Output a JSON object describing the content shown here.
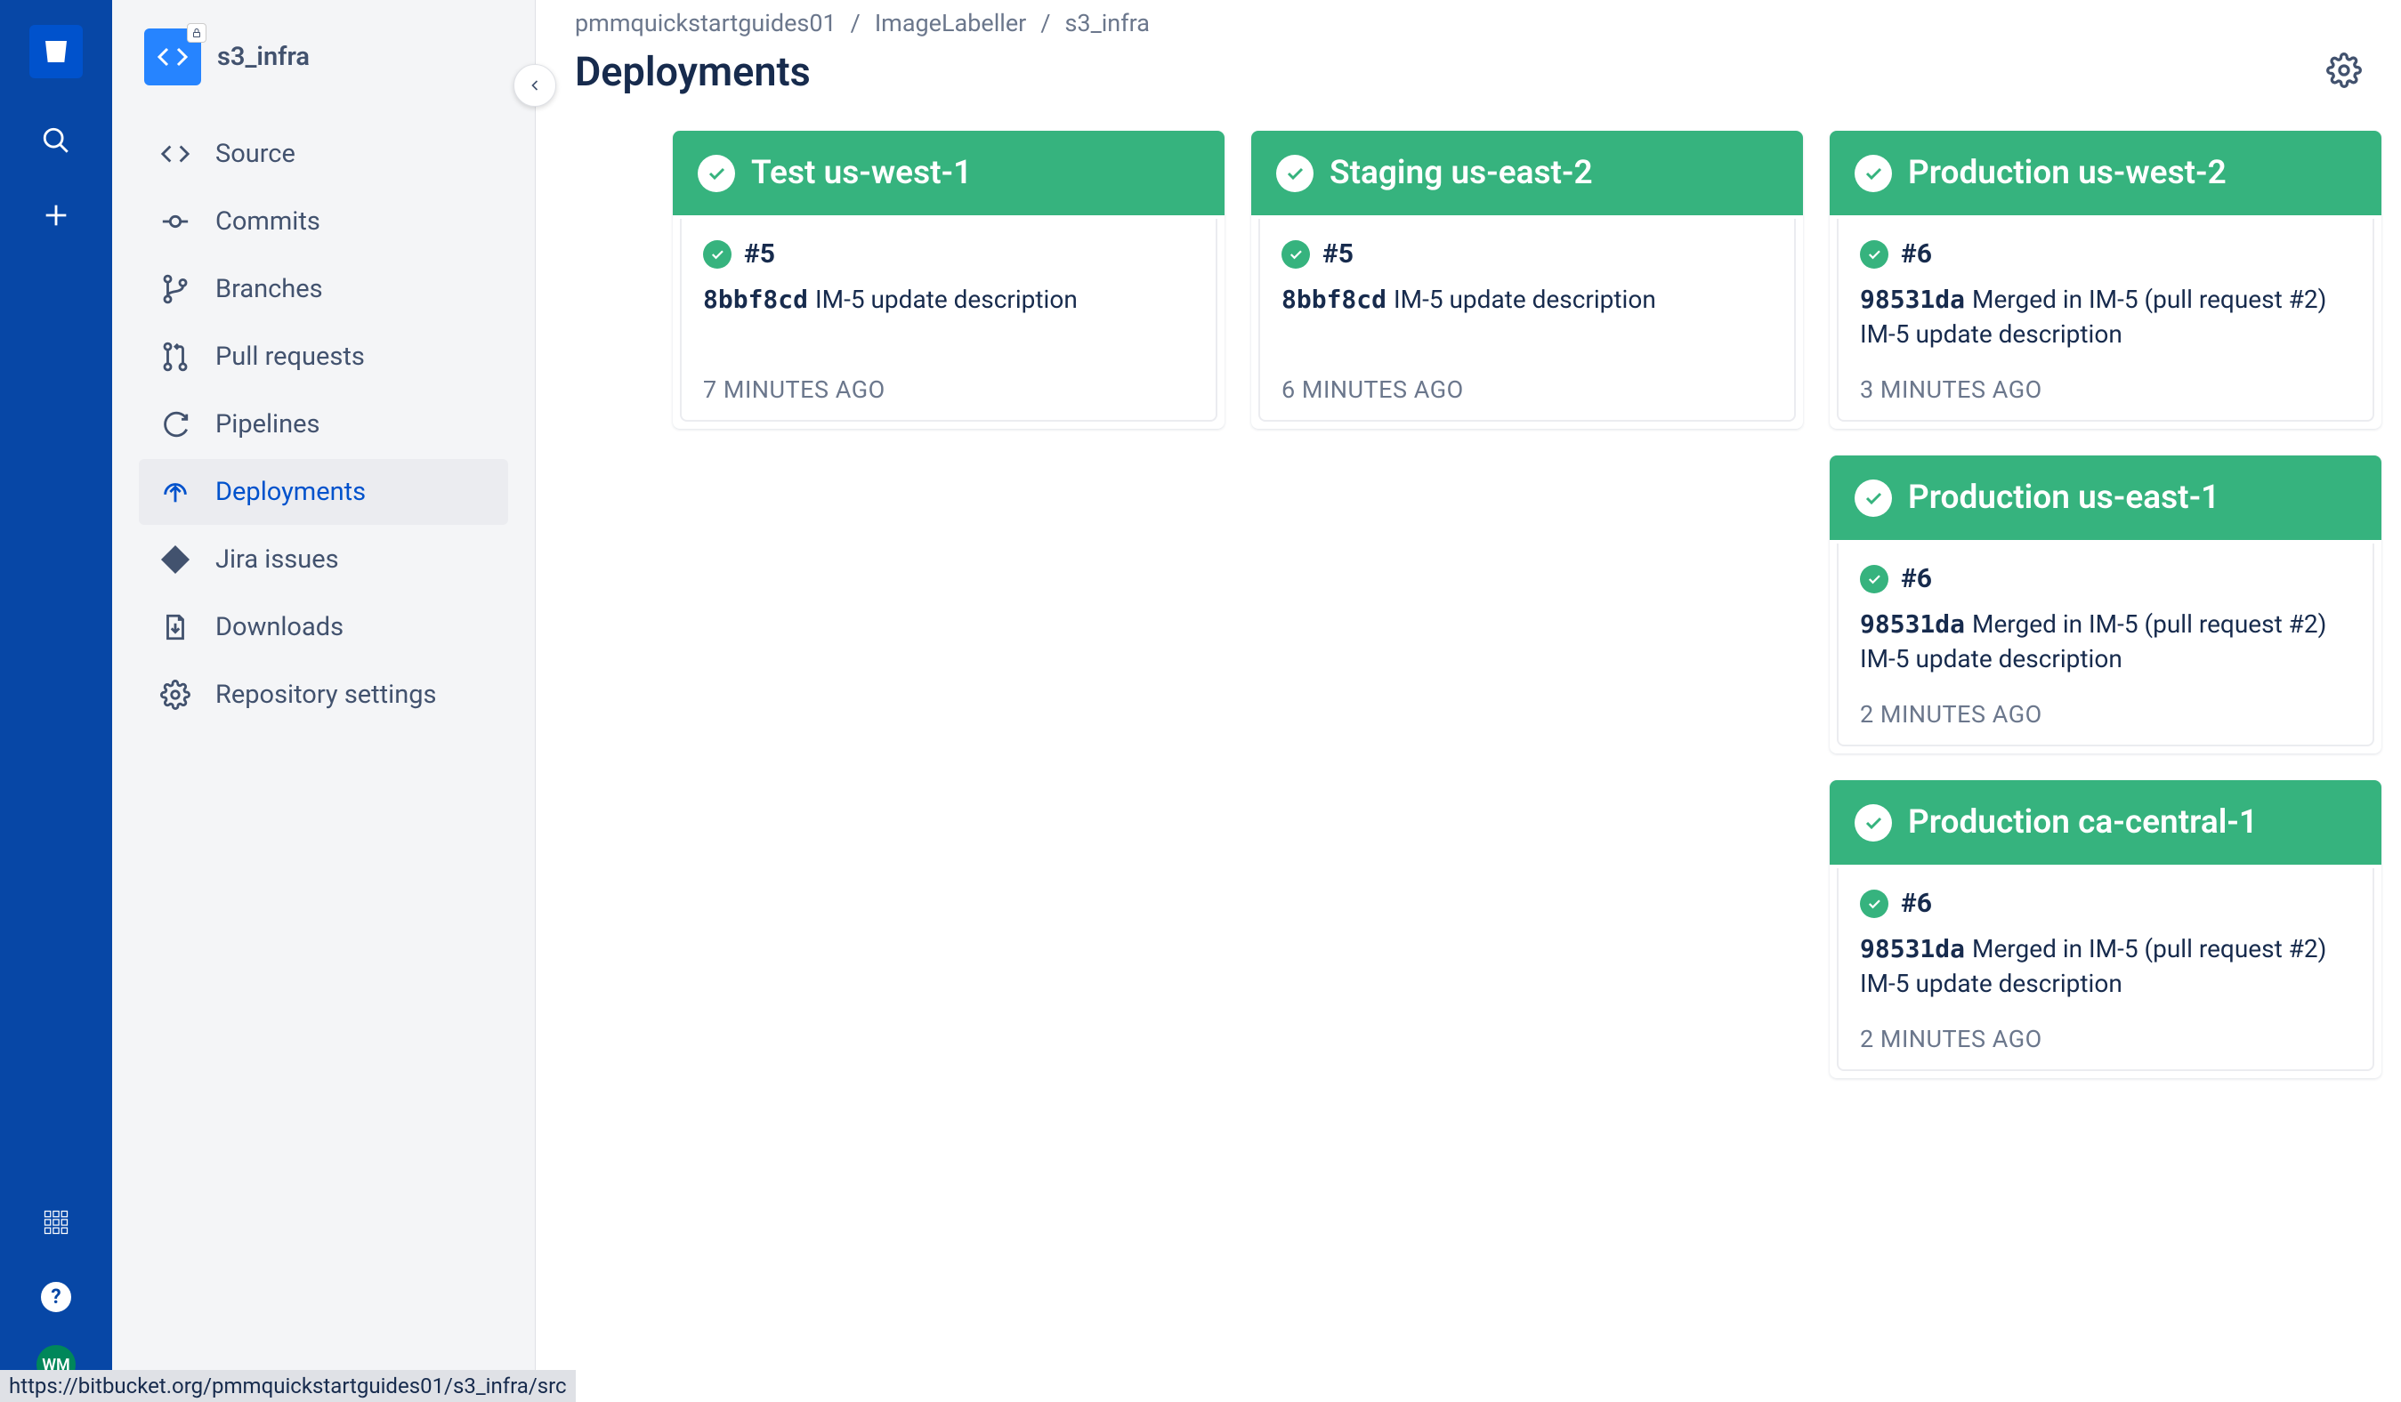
{
  "repo": {
    "name": "s3_infra"
  },
  "avatar": "WM",
  "sidebar": {
    "items": [
      {
        "icon": "code",
        "label": "Source"
      },
      {
        "icon": "commit",
        "label": "Commits"
      },
      {
        "icon": "branch",
        "label": "Branches"
      },
      {
        "icon": "pullreq",
        "label": "Pull requests"
      },
      {
        "icon": "pipeline",
        "label": "Pipelines"
      },
      {
        "icon": "deploy",
        "label": "Deployments"
      },
      {
        "icon": "jira",
        "label": "Jira issues"
      },
      {
        "icon": "download",
        "label": "Downloads"
      },
      {
        "icon": "settings",
        "label": "Repository settings"
      }
    ],
    "selected": 5
  },
  "breadcrumbs": [
    "pmmquickstartguides01",
    "ImageLabeller",
    "s3_infra"
  ],
  "page_title": "Deployments",
  "columns": [
    [
      {
        "env": "Test us-west-1",
        "deploy": {
          "num": "#5",
          "hash": "8bbf8cd",
          "msg": "IM-5 update description",
          "time": "7 MINUTES AGO"
        }
      }
    ],
    [
      {
        "env": "Staging us-east-2",
        "deploy": {
          "num": "#5",
          "hash": "8bbf8cd",
          "msg": "IM-5 update description",
          "time": "6 MINUTES AGO"
        }
      }
    ],
    [
      {
        "env": "Production us-west-2",
        "deploy": {
          "num": "#6",
          "hash": "98531da",
          "msg": "Merged in IM-5 (pull request #2) IM-5 update description",
          "time": "3 MINUTES AGO"
        }
      },
      {
        "env": "Production us-east-1",
        "deploy": {
          "num": "#6",
          "hash": "98531da",
          "msg": "Merged in IM-5 (pull request #2) IM-5 update description",
          "time": "2 MINUTES AGO"
        }
      },
      {
        "env": "Production ca-central-1",
        "deploy": {
          "num": "#6",
          "hash": "98531da",
          "msg": "Merged in IM-5 (pull request #2) IM-5 update description",
          "time": "2 MINUTES AGO"
        }
      }
    ]
  ],
  "status_url": "https://bitbucket.org/pmmquickstartguides01/s3_infra/src"
}
